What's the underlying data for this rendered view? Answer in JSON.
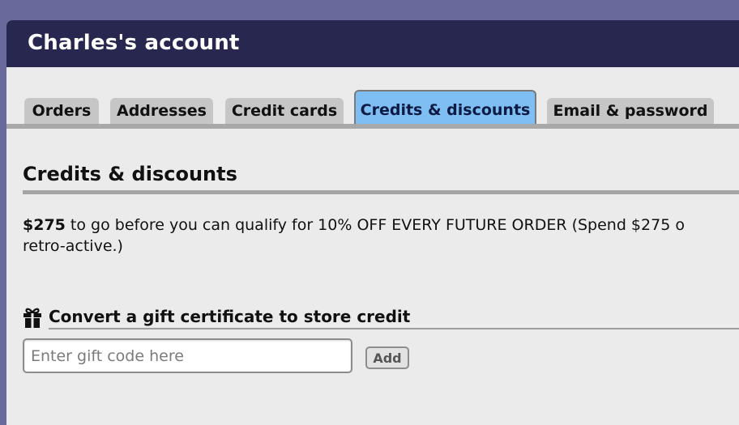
{
  "header": {
    "title": "Charles's account"
  },
  "tabs": [
    {
      "label": "Orders",
      "active": false
    },
    {
      "label": "Addresses",
      "active": false
    },
    {
      "label": "Credit cards",
      "active": false
    },
    {
      "label": "Credits & discounts",
      "active": true
    },
    {
      "label": "Email & password",
      "active": false
    }
  ],
  "section": {
    "title": "Credits & discounts",
    "amount": "$275",
    "message_line1": " to go before you can qualify for 10% OFF EVERY FUTURE ORDER (Spend $275 o",
    "message_line2": "retro-active.)"
  },
  "gift": {
    "title": "Convert a gift certificate to store credit",
    "placeholder": "Enter gift code here",
    "value": "",
    "add_label": "Add",
    "icon": "gift-icon"
  },
  "colors": {
    "outer_background": "#69699b",
    "header_background": "#27274f",
    "active_tab": "#7fbef2",
    "inactive_tab": "#c6c6c6"
  }
}
